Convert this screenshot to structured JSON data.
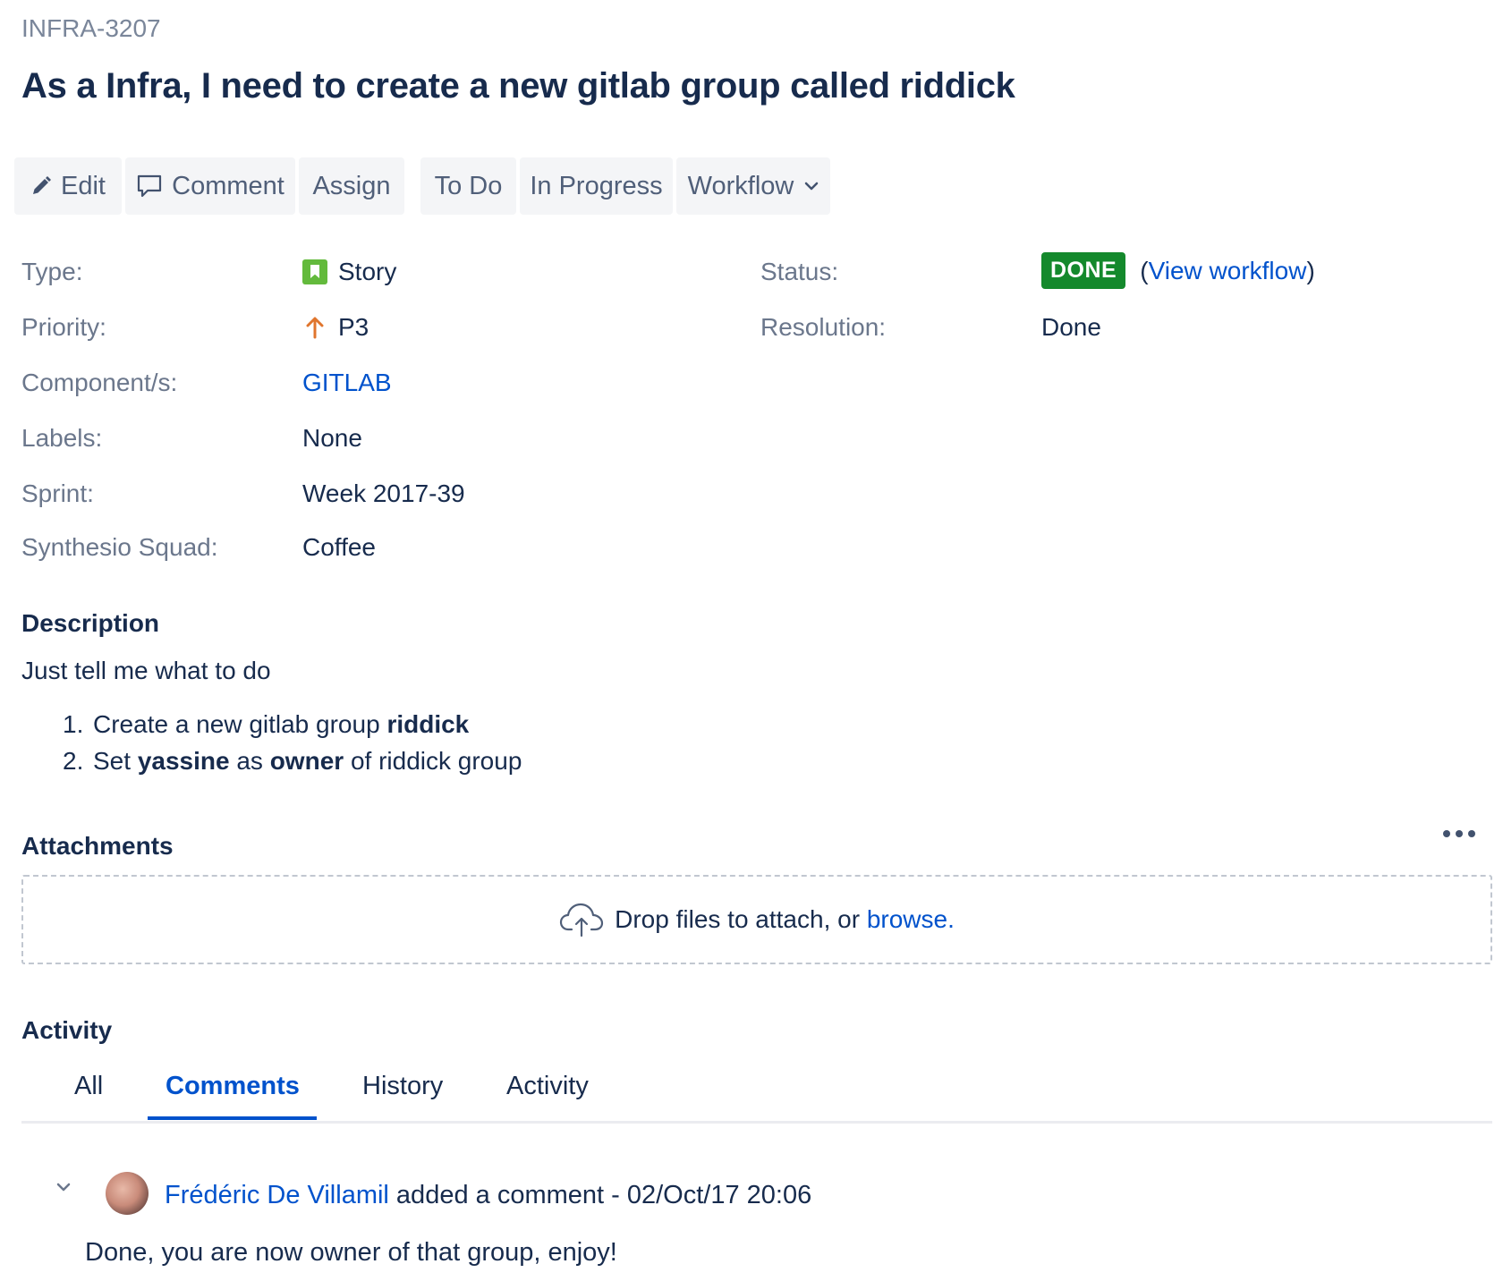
{
  "issue": {
    "key": "INFRA-3207",
    "title": "As a Infra, I need to create a new gitlab group called riddick"
  },
  "toolbar": {
    "edit": "Edit",
    "comment": "Comment",
    "assign": "Assign",
    "todo": "To Do",
    "in_progress": "In Progress",
    "workflow": "Workflow"
  },
  "details": {
    "type_label": "Type:",
    "type_value": "Story",
    "priority_label": "Priority:",
    "priority_value": "P3",
    "component_label": "Component/s:",
    "component_value": "GITLAB",
    "labels_label": "Labels:",
    "labels_value": "None",
    "sprint_label": "Sprint:",
    "sprint_value": "Week 2017-39",
    "squad_label": "Synthesio Squad:",
    "squad_value": "Coffee",
    "status_label": "Status:",
    "status_value": "DONE",
    "view_workflow_open": "(",
    "view_workflow": "View workflow",
    "view_workflow_close": ")",
    "resolution_label": "Resolution:",
    "resolution_value": "Done"
  },
  "description": {
    "heading": "Description",
    "intro": "Just tell me what to do",
    "items": [
      {
        "num": "1.",
        "parts": [
          "Create a new gitlab group ",
          "riddick"
        ]
      },
      {
        "num": "2.",
        "parts": [
          "Set ",
          "yassine",
          " as ",
          "owner",
          " of riddick group"
        ]
      }
    ]
  },
  "attachments": {
    "heading": "Attachments",
    "drop_text": "Drop files to attach, or ",
    "browse": "browse."
  },
  "activity": {
    "heading": "Activity",
    "tabs": [
      "All",
      "Comments",
      "History",
      "Activity"
    ],
    "active_tab": "Comments"
  },
  "comment": {
    "author": "Frédéric De Villamil",
    "action": " added a comment - ",
    "timestamp": "02/Oct/17 20:06",
    "body": "Done, you are now owner of that group, enjoy!"
  },
  "colors": {
    "accent": "#0052cc",
    "status_done": "#14892c",
    "story": "#63ba3c",
    "priority": "#e0752d"
  }
}
